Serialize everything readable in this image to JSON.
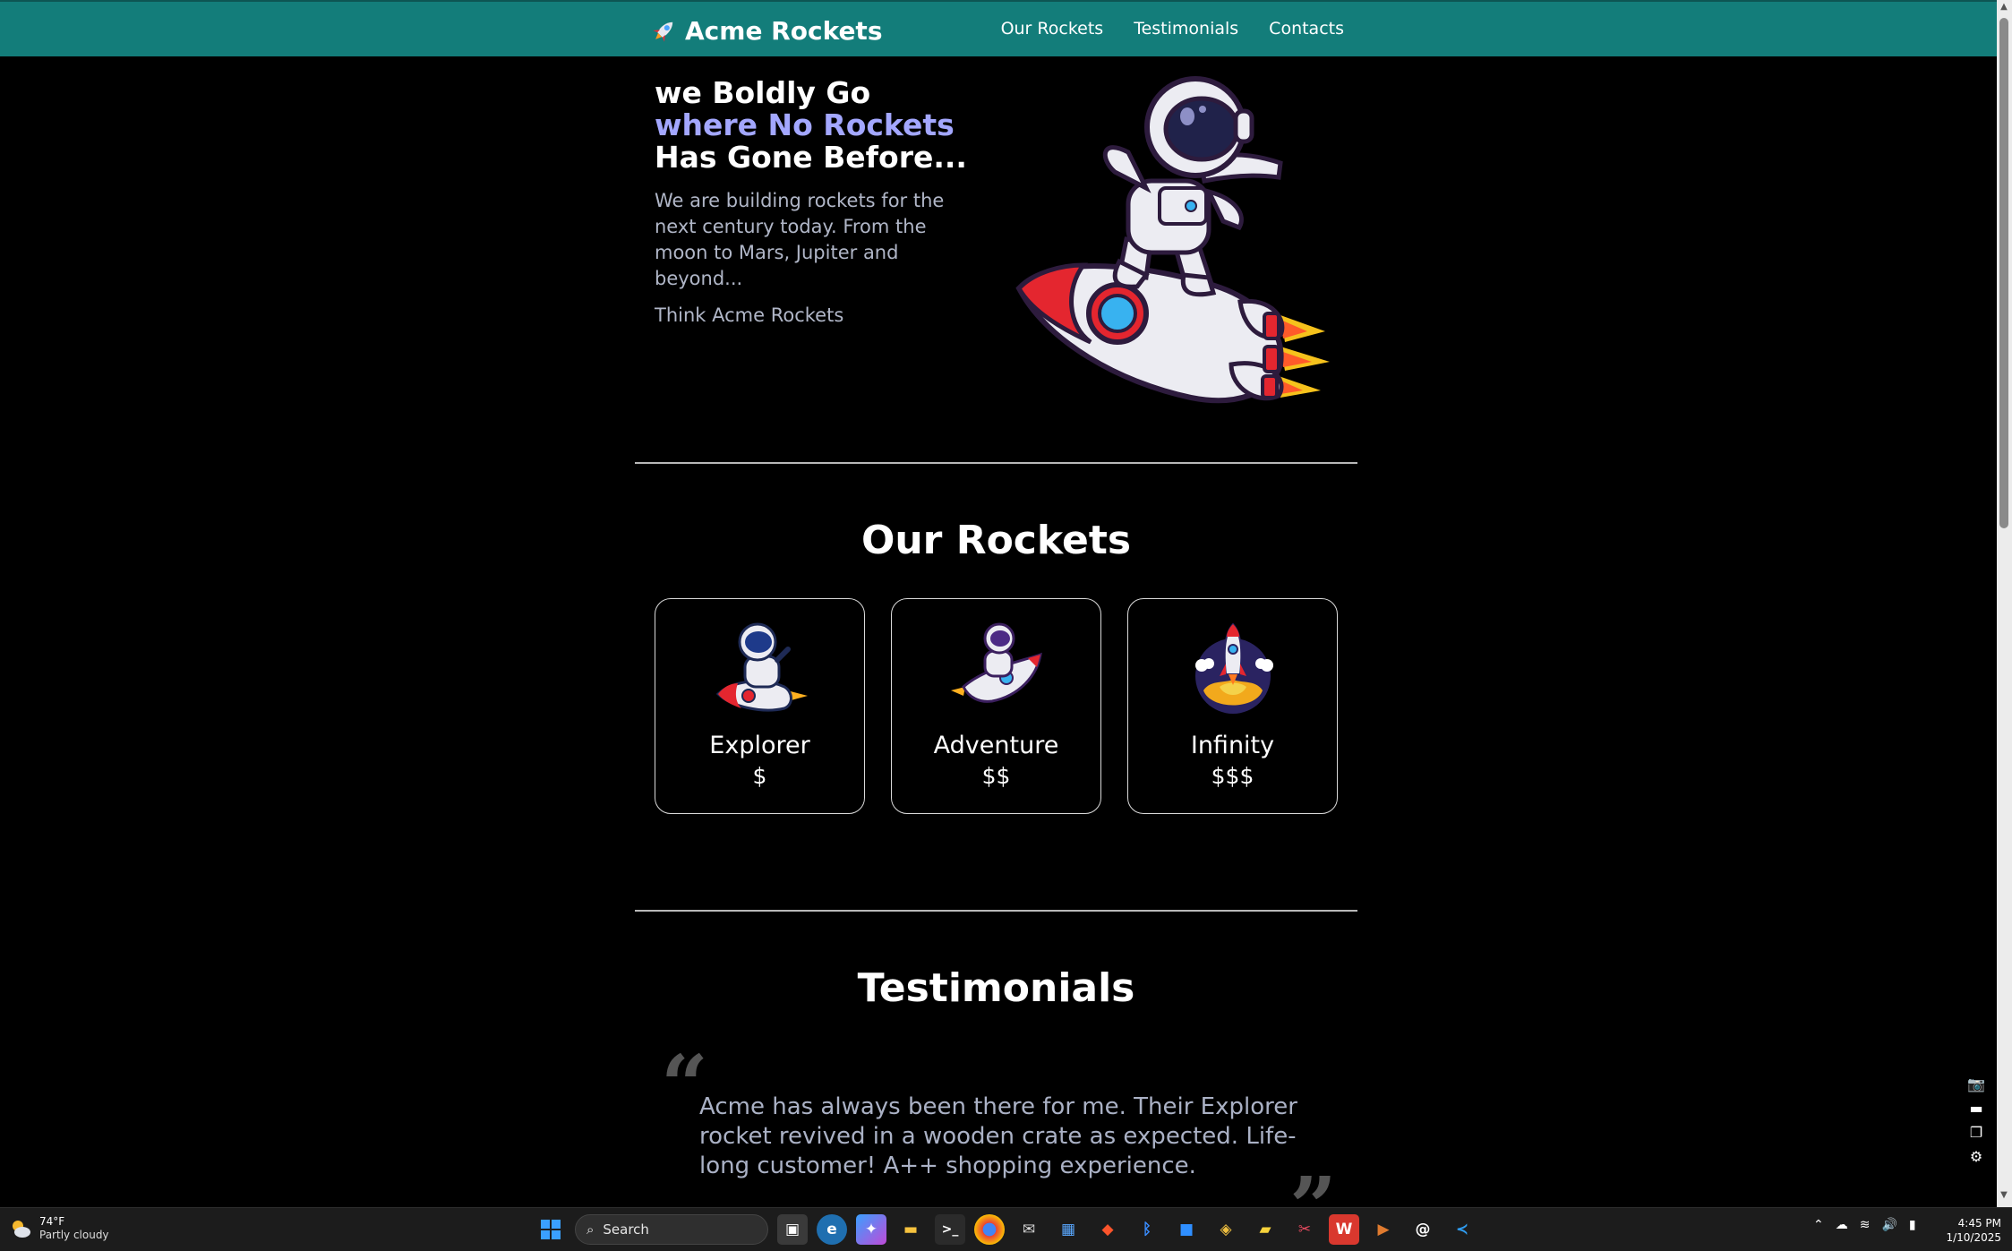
{
  "site": {
    "brand": "Acme Rockets",
    "nav": [
      "Our Rockets",
      "Testimonials",
      "Contacts"
    ]
  },
  "hero": {
    "title_part1": "we Boldly Go ",
    "title_accent": "where No Rockets",
    "title_part2": " Has Gone Before...",
    "text": "We are building rockets for the next century today. From the moon to Mars, Jupiter and beyond...",
    "tagline": "Think Acme Rockets"
  },
  "rockets": {
    "title": "Our Rockets",
    "items": [
      {
        "name": "Explorer",
        "price": "$"
      },
      {
        "name": "Adventure",
        "price": "$$"
      },
      {
        "name": "Infinity",
        "price": "$$$"
      }
    ]
  },
  "testimonials": {
    "title": "Testimonials",
    "open_quote": "“",
    "close_quote": "”",
    "quote": "Acme has always been there for me. Their Explorer rocket revived in a wooden crate as expected. Life-long customer! A++ shopping experience."
  },
  "side_tools": [
    "camera-icon",
    "video-icon",
    "window-icon",
    "settings-icon"
  ],
  "taskbar": {
    "weather_temp": "74°F",
    "weather_desc": "Partly cloudy",
    "search_label": "Search",
    "time": "4:45 PM",
    "date": "1/10/2025",
    "apps": [
      "windows-start-icon",
      "task-view-icon",
      "edge-icon",
      "copilot-icon",
      "file-explorer-icon",
      "terminal-icon",
      "chrome-icon",
      "mail-icon",
      "store-icon",
      "brave-icon",
      "bluetooth-icon",
      "app-icon",
      "git-icon",
      "sticky-notes-icon",
      "snipping-icon",
      "office-icon",
      "media-player-icon",
      "threads-icon",
      "vscode-icon"
    ]
  },
  "colors": {
    "header": "#137d7a",
    "accent": "#a3a7ff",
    "background": "#000000"
  }
}
